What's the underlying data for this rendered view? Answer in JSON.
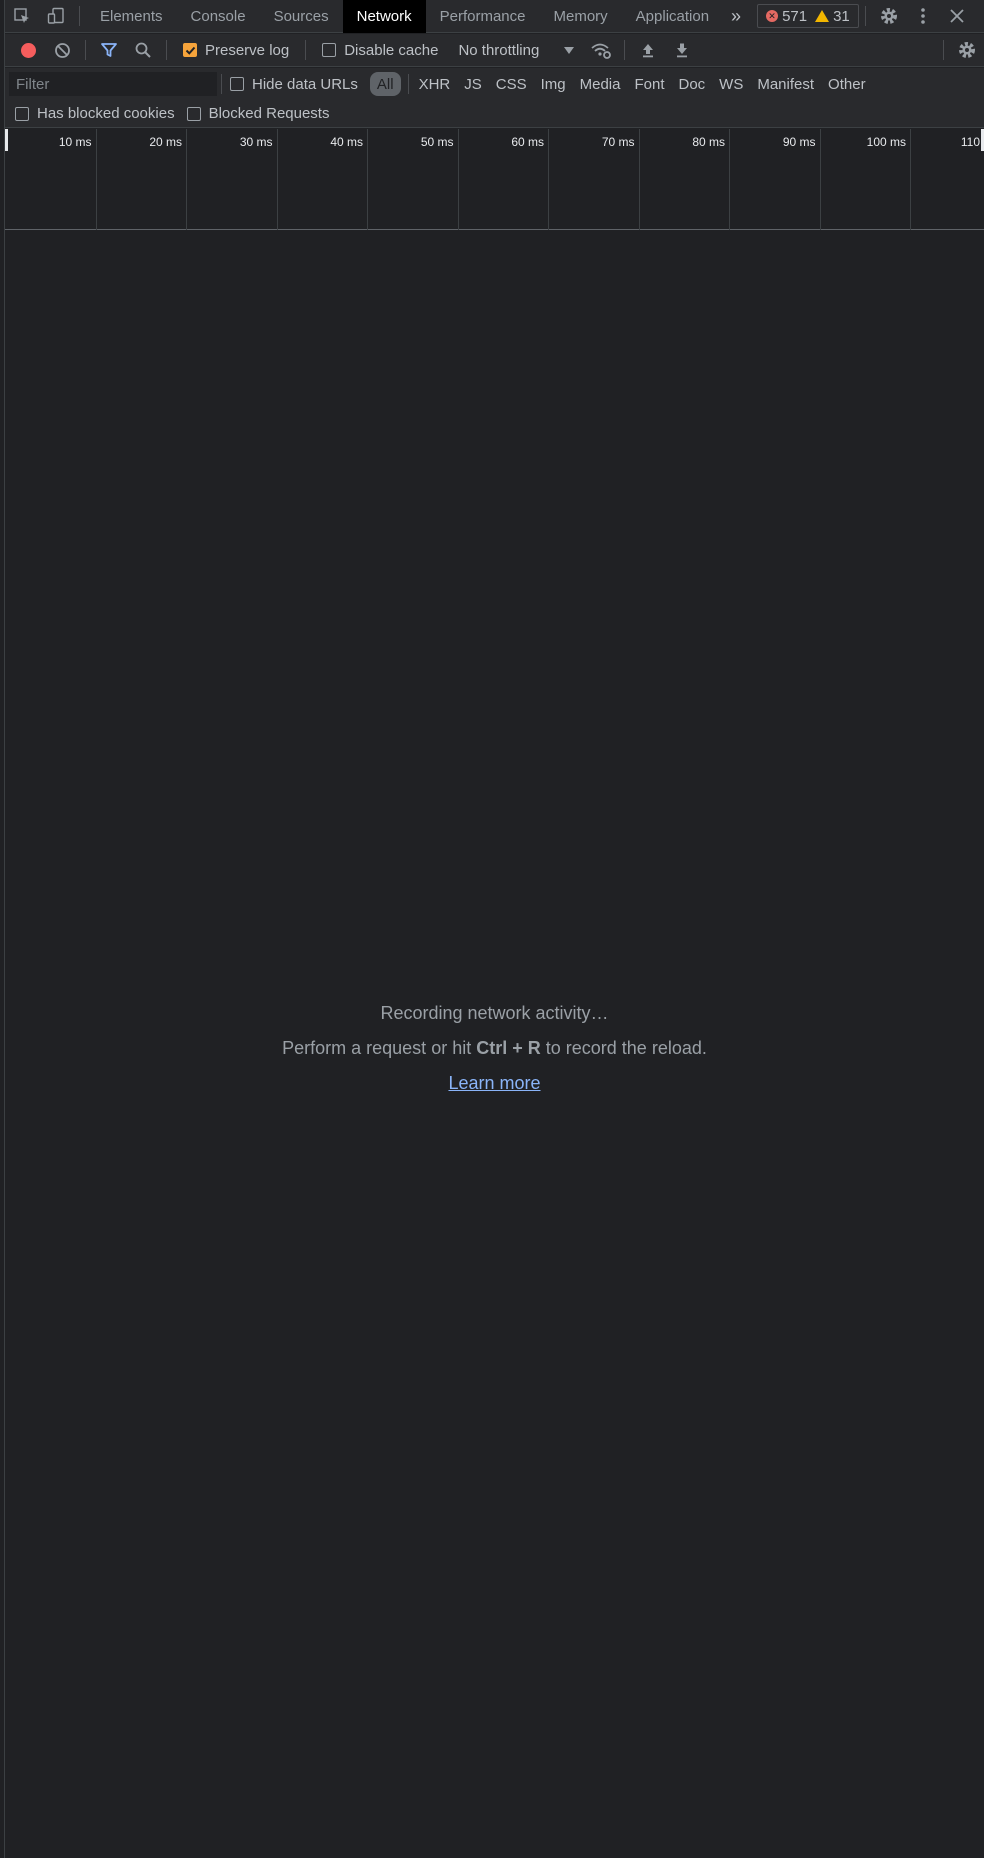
{
  "tabs": [
    "Elements",
    "Console",
    "Sources",
    "Network",
    "Performance",
    "Memory",
    "Application"
  ],
  "active_tab": "Network",
  "counts": {
    "errors": "571",
    "warnings": "31"
  },
  "toolbar": {
    "preserve_log": "Preserve log",
    "disable_cache": "Disable cache",
    "throttling": "No throttling"
  },
  "filter": {
    "placeholder": "Filter",
    "hide_data_urls": "Hide data URLs",
    "types": [
      "All",
      "XHR",
      "JS",
      "CSS",
      "Img",
      "Media",
      "Font",
      "Doc",
      "WS",
      "Manifest",
      "Other"
    ]
  },
  "blocked": {
    "has_blocked_cookies": "Has blocked cookies",
    "blocked_requests": "Blocked Requests"
  },
  "timeline_ticks": [
    "10 ms",
    "20 ms",
    "30 ms",
    "40 ms",
    "50 ms",
    "60 ms",
    "70 ms",
    "80 ms",
    "90 ms",
    "100 ms",
    "110"
  ],
  "empty_state": {
    "recording": "Recording network activity…",
    "perform_pre": "Perform a request or hit",
    "shortcut": "Ctrl + R",
    "perform_post": "to record the reload.",
    "learn_more": "Learn more"
  },
  "colors": {
    "record": "#f55d5d",
    "checkbox_checked": "#f6a43b",
    "link": "#8ab4f8",
    "error": "#e46962",
    "warning": "#f2b600"
  }
}
